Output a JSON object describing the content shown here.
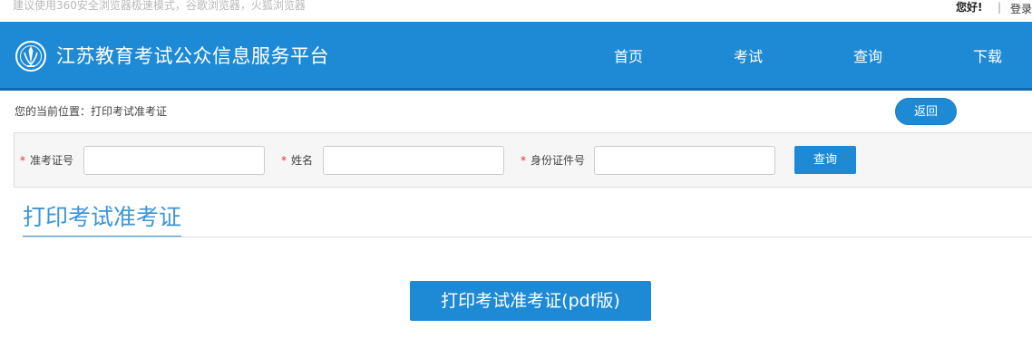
{
  "topbar": {
    "tip": "建议使用360安全浏览器极速模式，谷歌浏览器，火狐浏览器",
    "hello": "您好!",
    "separator": "|",
    "login": "登录"
  },
  "header": {
    "site_title": "江苏教育考试公众信息服务平台",
    "logo_icon": "graduation-logo-icon",
    "nav": {
      "home": "首页",
      "exam": "考试",
      "query": "查询",
      "download": "下载"
    }
  },
  "breadcrumb": "您的当前位置：打印考试准考证",
  "back_label": "返回",
  "form": {
    "required_mark": "*",
    "ticket_label": "准考证号",
    "ticket_value": "",
    "name_label": "姓名",
    "name_value": "",
    "id_label": "身份证件号",
    "id_value": "",
    "query_label": "查询"
  },
  "section_title": "打印考试准考证",
  "print_label": "打印考试准考证(pdf版)",
  "colors": {
    "accent": "#1e8ad6",
    "title_blue": "#3b95d9",
    "required_red": "#e0312f"
  }
}
